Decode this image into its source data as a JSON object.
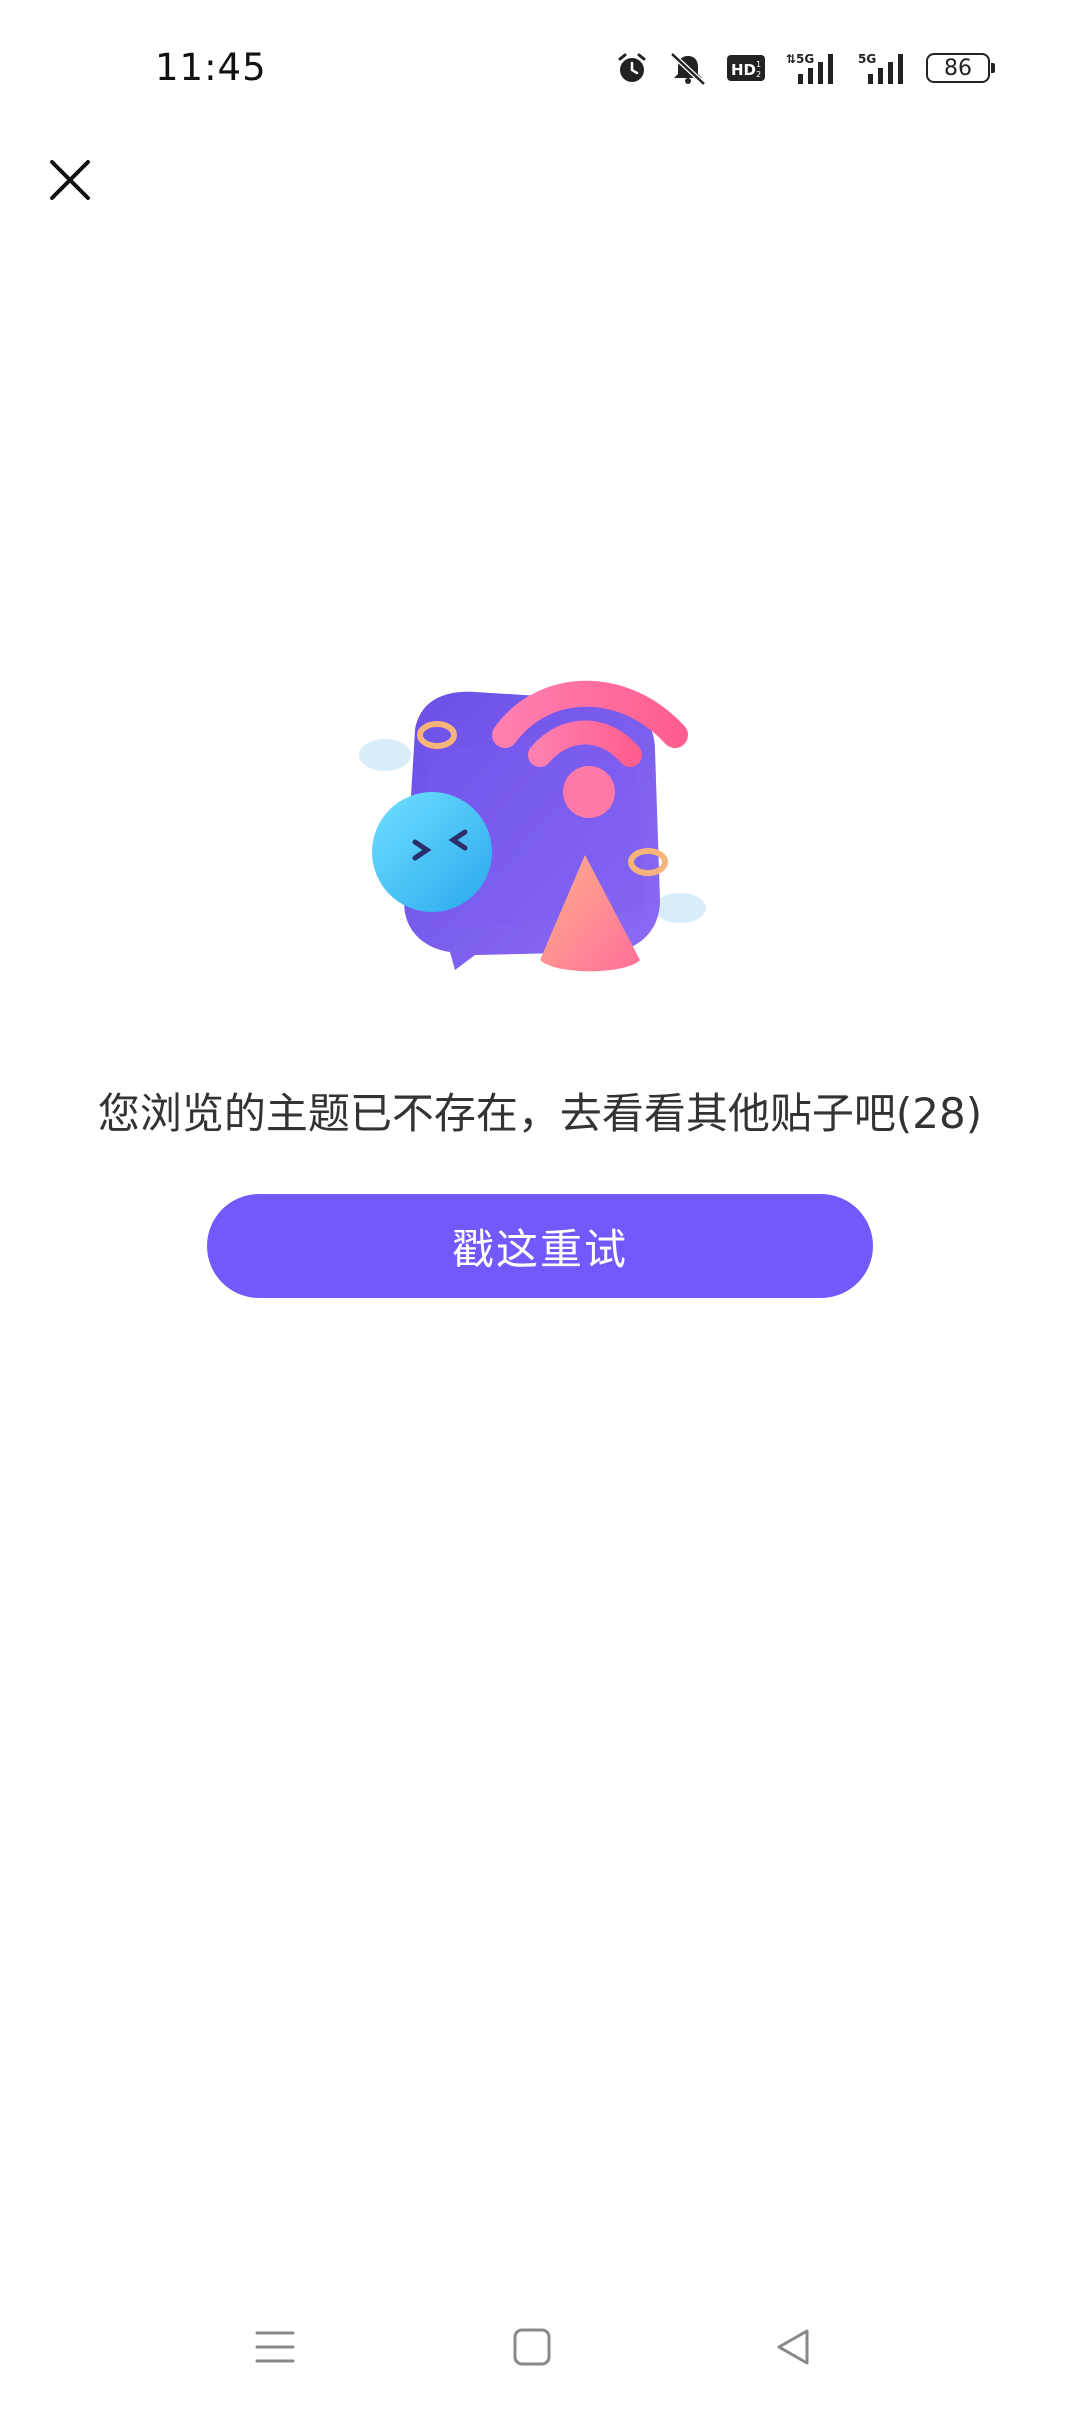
{
  "status_bar": {
    "time": "11:45",
    "icons": [
      "alarm-icon",
      "mute-icon",
      "hd-voice-icon",
      "5g-signal-icon",
      "5g-signal-icon"
    ],
    "battery_level": "86"
  },
  "header": {
    "close_icon": "close-icon"
  },
  "empty_state": {
    "illustration": "broken-signal-illustration",
    "message": "您浏览的主题已不存在，去看看其他贴子吧(28)",
    "retry_label": "戳这重试"
  },
  "nav_bar": {
    "icons": [
      "menu-icon",
      "home-icon",
      "back-icon"
    ]
  },
  "colors": {
    "accent": "#7359fb",
    "background": "#ffffff",
    "text": "#333333"
  }
}
